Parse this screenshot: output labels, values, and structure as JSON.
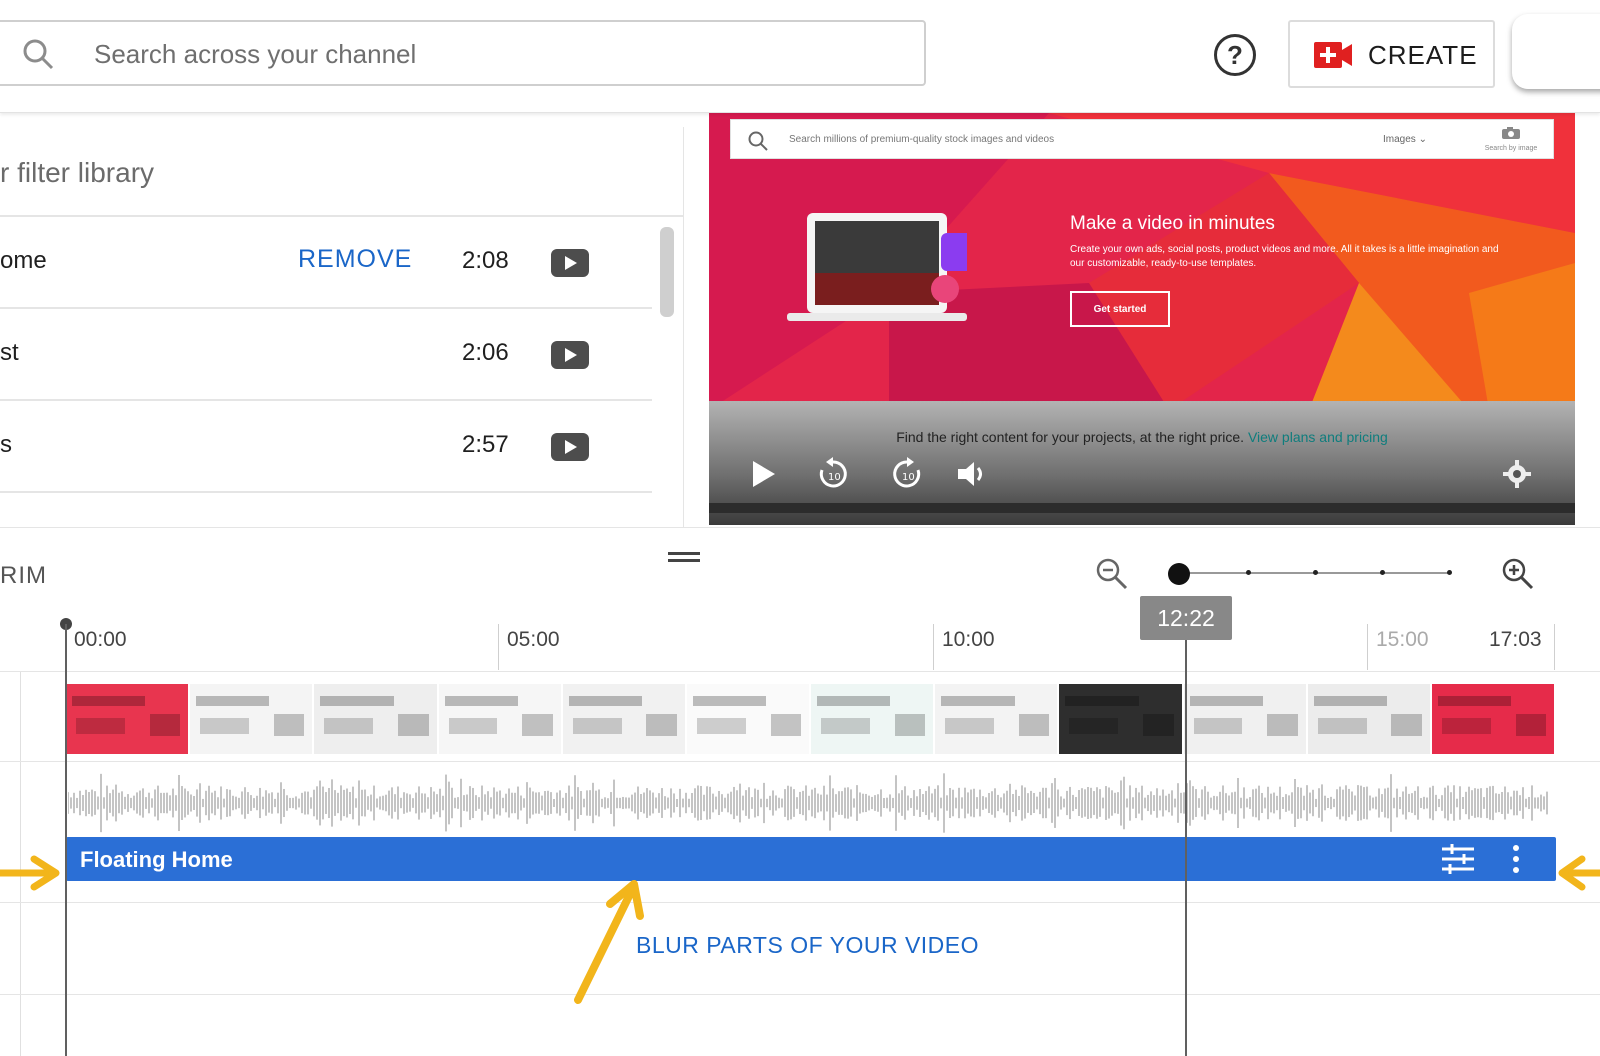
{
  "header": {
    "search_placeholder": "Search across your channel",
    "help_icon": "help-circle-icon",
    "create_label": "CREATE",
    "create_icon": "video-add-icon"
  },
  "library": {
    "search_text": "r filter library",
    "tracks": [
      {
        "title": "ome",
        "remove_label": "REMOVE",
        "duration": "2:08"
      },
      {
        "title": "st",
        "duration": "2:06"
      },
      {
        "title": "s",
        "duration": "2:57"
      }
    ]
  },
  "preview": {
    "search_placeholder": "Search millions of premium-quality stock images and videos",
    "images_select": "Images ⌄",
    "camera_sub": "Search by image",
    "promo_heading": "Make a video in minutes",
    "promo_body": "Create your own ads, social posts, product videos and more. All it takes is a little imagination and our customizable, ready-to-use templates.",
    "promo_cta": "Get started",
    "pricing_text": "Find the right content for your projects, at the right price.",
    "pricing_link": "View plans and pricing",
    "rewind_label": "10",
    "forward_label": "10"
  },
  "timeline": {
    "trim_label": "RIM",
    "ruler_labels": [
      "00:00",
      "05:00",
      "10:00",
      "15:00",
      "17:03"
    ],
    "playhead_time": "12:22",
    "zoom_level": 0,
    "audio_clip_title": "Floating Home",
    "blur_label": "BLUR PARTS OF YOUR VIDEO"
  },
  "colors": {
    "accent_blue": "#1a66c8",
    "audio_clip": "#2b6fd6",
    "annotation_arrow": "#f2b51b",
    "create_red": "#e02020"
  }
}
